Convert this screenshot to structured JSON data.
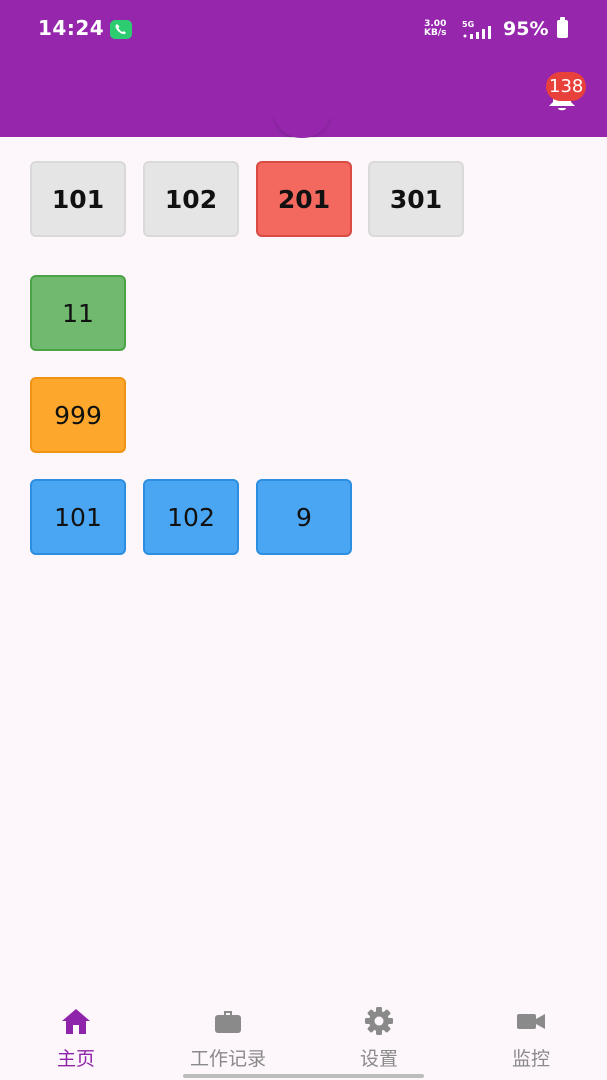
{
  "status_bar": {
    "time": "14:24",
    "net_speed_value": "3.00",
    "net_speed_unit": "KB/s",
    "network_type": "5G",
    "battery": "95%",
    "call_icon": "phone-icon"
  },
  "app_bar": {
    "color": "#9627ad",
    "notification_count": "138",
    "notification_icon": "bell-icon"
  },
  "rooms": [
    {
      "label": "101",
      "status": "normal"
    },
    {
      "label": "102",
      "status": "normal"
    },
    {
      "label": "201",
      "status": "alert"
    },
    {
      "label": "301",
      "status": "normal"
    }
  ],
  "green_tiles": [
    {
      "label": "11"
    }
  ],
  "orange_tiles": [
    {
      "label": "999"
    }
  ],
  "blue_tiles": [
    {
      "label": "101"
    },
    {
      "label": "102"
    },
    {
      "label": "9"
    }
  ],
  "colors": {
    "alert": "#f4695f",
    "green": "#70b96e",
    "orange": "#fda82c",
    "blue": "#4aa6f2",
    "active_nav": "#8e24aa",
    "inactive_nav": "#8a8a8a"
  },
  "bottom_nav": [
    {
      "label": "主页",
      "icon": "home-icon",
      "active": true
    },
    {
      "label": "工作记录",
      "icon": "briefcase-icon",
      "active": false
    },
    {
      "label": "设置",
      "icon": "gear-icon",
      "active": false
    },
    {
      "label": "监控",
      "icon": "video-camera-icon",
      "active": false
    }
  ]
}
